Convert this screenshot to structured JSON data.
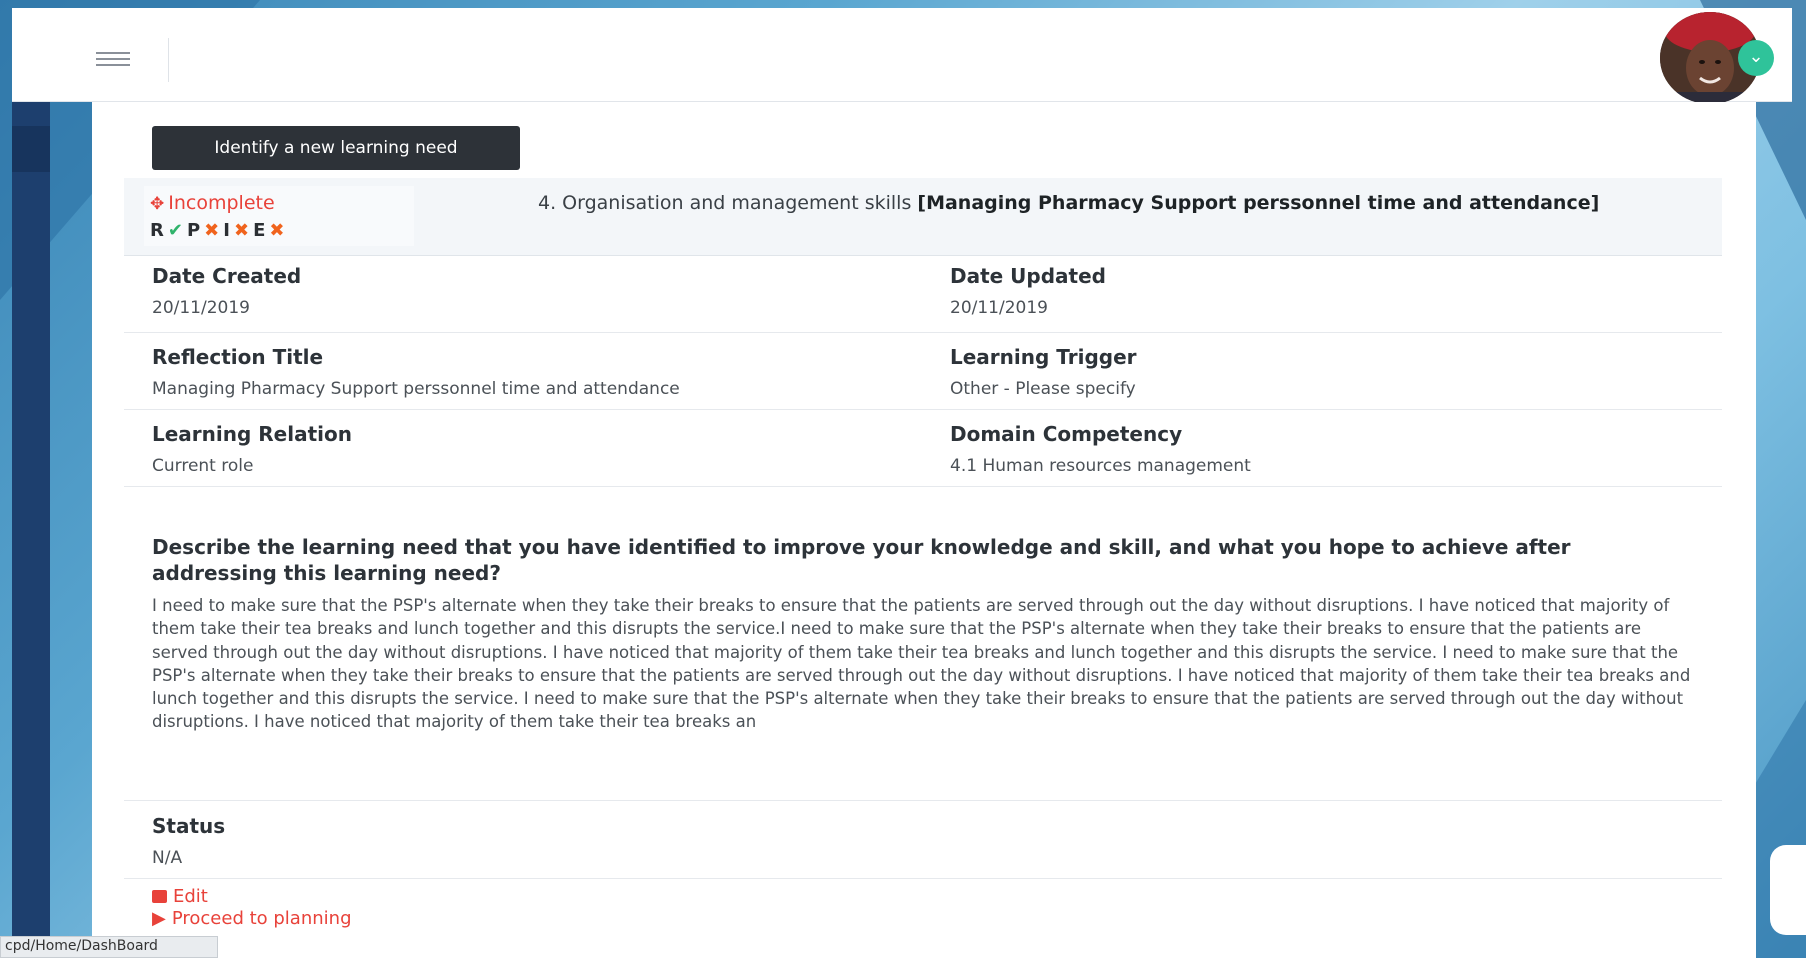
{
  "topbar": {
    "menu_icon": "hamburger-icon",
    "avatar_badge_icon": "chevron-down-icon"
  },
  "toolbar": {
    "new_need_label": "Identify a new learning need"
  },
  "summary": {
    "status_icon": "crosshair-icon",
    "status_text": "Incomplete",
    "stage_letters": [
      "R",
      "P",
      "I",
      "E"
    ],
    "stage_marks": [
      {
        "letter": "R",
        "mark": "✔",
        "state": "done"
      },
      {
        "letter": "P",
        "mark": "✖",
        "state": "missing"
      },
      {
        "letter": "I",
        "mark": "✖",
        "state": "missing"
      },
      {
        "letter": "E",
        "mark": "✖",
        "state": "missing"
      }
    ],
    "title_prefix": "4. Organisation and management skills ",
    "title_bold": "[Managing Pharmacy Support perssonnel time and attendance]"
  },
  "fields": {
    "date_created_label": "Date Created",
    "date_created_value": "20/11/2019",
    "date_updated_label": "Date Updated",
    "date_updated_value": "20/11/2019",
    "reflection_title_label": "Reflection Title",
    "reflection_title_value": "Managing Pharmacy Support perssonnel time and attendance",
    "learning_trigger_label": "Learning Trigger",
    "learning_trigger_value": "Other - Please specify",
    "learning_relation_label": "Learning Relation",
    "learning_relation_value": "Current role",
    "domain_competency_label": "Domain Competency",
    "domain_competency_value": "4.1 Human resources management"
  },
  "question": "Describe the learning need that you have identified to improve your knowledge and skill, and what you hope to achieve after addressing this learning need?",
  "answer": "I need to make sure that the PSP's alternate when they take their breaks to ensure that the patients are served through out the day without disruptions. I have noticed that majority of them take their tea breaks and lunch together and this disrupts the service.I need to make sure that the PSP's alternate when they take their breaks to ensure that the patients are served through out the day without disruptions. I have noticed that majority of them take their tea breaks and lunch together and this disrupts the service. I need to make sure that the PSP's alternate when they take their breaks to ensure that the patients are served through out the day without disruptions. I have noticed that majority of them take their tea breaks and lunch together and this disrupts the service. I need to make sure that the PSP's alternate when they take their breaks to ensure that the patients are served through out the day without disruptions. I have noticed that majority of them take their tea breaks an",
  "status": {
    "label": "Status",
    "value": "N/A"
  },
  "actions": {
    "edit_icon": "edit-icon",
    "edit_label": "Edit",
    "proceed_icon": "play-icon",
    "proceed_label": "Proceed to planning"
  },
  "statusbar": {
    "url": "cpd/Home/DashBoard"
  },
  "colors": {
    "accent_red": "#e8423a",
    "ok_green": "#2fb36b",
    "x_orange": "#f0631d",
    "sidebar": "#1d3f6e"
  }
}
